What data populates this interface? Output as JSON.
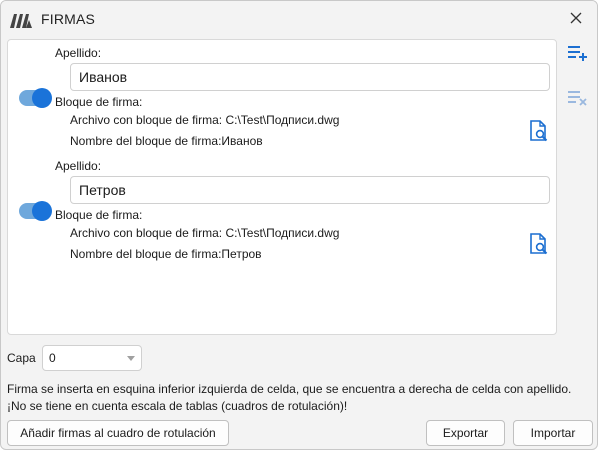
{
  "window": {
    "title": "FIRMAS"
  },
  "icons": {
    "app": "app-logo-icon",
    "close": "close-icon",
    "add_list": "list-add-icon",
    "remove_list": "list-remove-icon",
    "preview": "file-search-icon"
  },
  "colors": {
    "accent": "#1a73d9",
    "toggle_track": "#6fa8dc",
    "icon_blue": "#1c6fd1",
    "icon_disabled": "#9ab8df"
  },
  "labels": {
    "apellido": "Apellido:",
    "bloque": "Bloque de firma:",
    "archivo": "Archivo con bloque de firma:",
    "nombre": "Nombre del bloque de firma:"
  },
  "entries": [
    {
      "surname": "Иванов",
      "enabled": true,
      "file": "C:\\Test\\Подписи.dwg",
      "block_name": "Иванов"
    },
    {
      "surname": "Петров",
      "enabled": true,
      "file": "C:\\Test\\Подписи.dwg",
      "block_name": "Петров"
    }
  ],
  "capa": {
    "label": "Capa",
    "value": "0"
  },
  "note": "Firma se inserta en esquina inferior izquierda de celda, que se encuentra a derecha de celda con apellido. ¡No se tiene en cuenta escala de tablas (cuadros de rotulación)!",
  "buttons": {
    "add": "Añadir firmas al cuadro de rotulación",
    "export": "Exportar",
    "import": "Importar"
  }
}
